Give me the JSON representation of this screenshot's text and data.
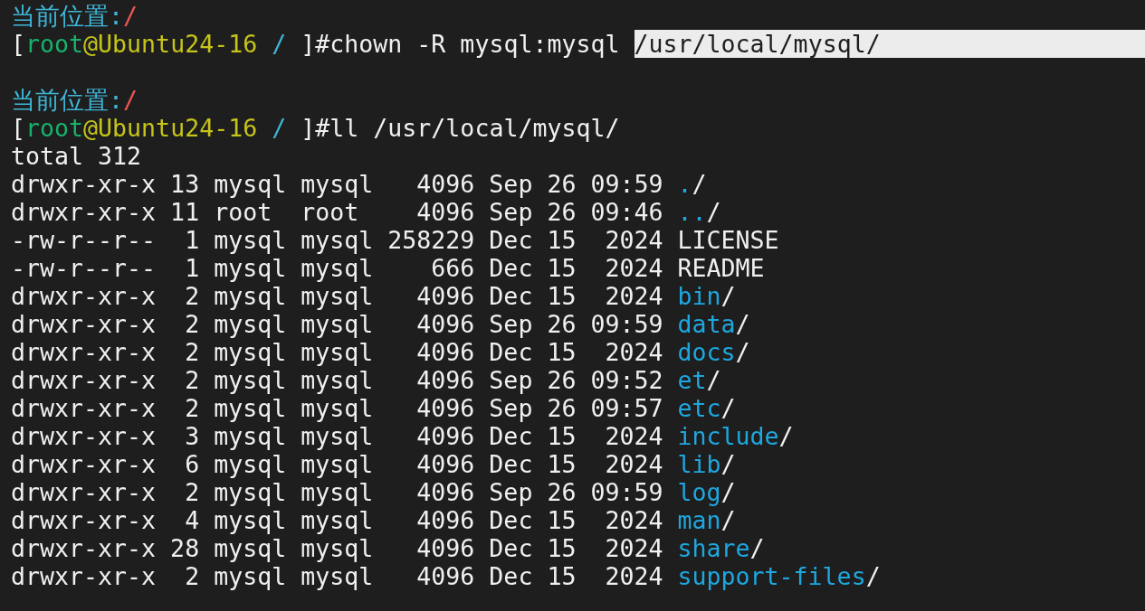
{
  "terminal": {
    "lines": [
      {
        "kind": "output",
        "segments": [
          {
            "kind": "label",
            "text": "当前位置:"
          },
          {
            "kind": "path",
            "text": "/"
          }
        ]
      },
      {
        "kind": "output",
        "segments": [
          {
            "kind": "plain",
            "text": "["
          },
          {
            "kind": "user",
            "text": "root"
          },
          {
            "kind": "host",
            "text": "@Ubuntu24-16"
          },
          {
            "kind": "cwd",
            "text": " / "
          },
          {
            "kind": "plain",
            "text": "]#chown -R mysql:mysql "
          },
          {
            "kind": "selected",
            "text": "/usr/local/mysql/"
          }
        ]
      },
      {
        "kind": "blank"
      },
      {
        "kind": "output",
        "segments": [
          {
            "kind": "label",
            "text": "当前位置:"
          },
          {
            "kind": "path",
            "text": "/"
          }
        ]
      },
      {
        "kind": "output",
        "segments": [
          {
            "kind": "plain",
            "text": "["
          },
          {
            "kind": "user",
            "text": "root"
          },
          {
            "kind": "host",
            "text": "@Ubuntu24-16"
          },
          {
            "kind": "cwd",
            "text": " / "
          },
          {
            "kind": "plain",
            "text": "]#ll /usr/local/mysql/"
          }
        ]
      },
      {
        "kind": "output",
        "segments": [
          {
            "kind": "plain",
            "text": "total 312"
          }
        ]
      },
      {
        "kind": "output",
        "segments": [
          {
            "kind": "plain",
            "text": "drwxr-xr-x 13 mysql mysql   4096 Sep 26 09:59 "
          },
          {
            "kind": "dir",
            "text": "."
          },
          {
            "kind": "plain",
            "text": "/"
          }
        ]
      },
      {
        "kind": "output",
        "segments": [
          {
            "kind": "plain",
            "text": "drwxr-xr-x 11 root  root    4096 Sep 26 09:46 "
          },
          {
            "kind": "dir",
            "text": ".."
          },
          {
            "kind": "plain",
            "text": "/"
          }
        ]
      },
      {
        "kind": "output",
        "segments": [
          {
            "kind": "plain",
            "text": "-rw-r--r--  1 mysql mysql 258229 Dec 15  2024 LICENSE"
          }
        ]
      },
      {
        "kind": "output",
        "segments": [
          {
            "kind": "plain",
            "text": "-rw-r--r--  1 mysql mysql    666 Dec 15  2024 README"
          }
        ]
      },
      {
        "kind": "output",
        "segments": [
          {
            "kind": "plain",
            "text": "drwxr-xr-x  2 mysql mysql   4096 Dec 15  2024 "
          },
          {
            "kind": "dir",
            "text": "bin"
          },
          {
            "kind": "plain",
            "text": "/"
          }
        ]
      },
      {
        "kind": "output",
        "segments": [
          {
            "kind": "plain",
            "text": "drwxr-xr-x  2 mysql mysql   4096 Sep 26 09:59 "
          },
          {
            "kind": "dir",
            "text": "data"
          },
          {
            "kind": "plain",
            "text": "/"
          }
        ]
      },
      {
        "kind": "output",
        "segments": [
          {
            "kind": "plain",
            "text": "drwxr-xr-x  2 mysql mysql   4096 Dec 15  2024 "
          },
          {
            "kind": "dir",
            "text": "docs"
          },
          {
            "kind": "plain",
            "text": "/"
          }
        ]
      },
      {
        "kind": "output",
        "segments": [
          {
            "kind": "plain",
            "text": "drwxr-xr-x  2 mysql mysql   4096 Sep 26 09:52 "
          },
          {
            "kind": "dir",
            "text": "et"
          },
          {
            "kind": "plain",
            "text": "/"
          }
        ]
      },
      {
        "kind": "output",
        "segments": [
          {
            "kind": "plain",
            "text": "drwxr-xr-x  2 mysql mysql   4096 Sep 26 09:57 "
          },
          {
            "kind": "dir",
            "text": "etc"
          },
          {
            "kind": "plain",
            "text": "/"
          }
        ]
      },
      {
        "kind": "output",
        "segments": [
          {
            "kind": "plain",
            "text": "drwxr-xr-x  3 mysql mysql   4096 Dec 15  2024 "
          },
          {
            "kind": "dir",
            "text": "include"
          },
          {
            "kind": "plain",
            "text": "/"
          }
        ]
      },
      {
        "kind": "output",
        "segments": [
          {
            "kind": "plain",
            "text": "drwxr-xr-x  6 mysql mysql   4096 Dec 15  2024 "
          },
          {
            "kind": "dir",
            "text": "lib"
          },
          {
            "kind": "plain",
            "text": "/"
          }
        ]
      },
      {
        "kind": "output",
        "segments": [
          {
            "kind": "plain",
            "text": "drwxr-xr-x  2 mysql mysql   4096 Sep 26 09:59 "
          },
          {
            "kind": "dir",
            "text": "log"
          },
          {
            "kind": "plain",
            "text": "/"
          }
        ]
      },
      {
        "kind": "output",
        "segments": [
          {
            "kind": "plain",
            "text": "drwxr-xr-x  4 mysql mysql   4096 Dec 15  2024 "
          },
          {
            "kind": "dir",
            "text": "man"
          },
          {
            "kind": "plain",
            "text": "/"
          }
        ]
      },
      {
        "kind": "output",
        "segments": [
          {
            "kind": "plain",
            "text": "drwxr-xr-x 28 mysql mysql   4096 Dec 15  2024 "
          },
          {
            "kind": "dir",
            "text": "share"
          },
          {
            "kind": "plain",
            "text": "/"
          }
        ]
      },
      {
        "kind": "output",
        "segments": [
          {
            "kind": "plain",
            "text": "drwxr-xr-x  2 mysql mysql   4096 Dec 15  2024 "
          },
          {
            "kind": "dir",
            "text": "support-files"
          },
          {
            "kind": "plain",
            "text": "/"
          }
        ]
      }
    ]
  }
}
